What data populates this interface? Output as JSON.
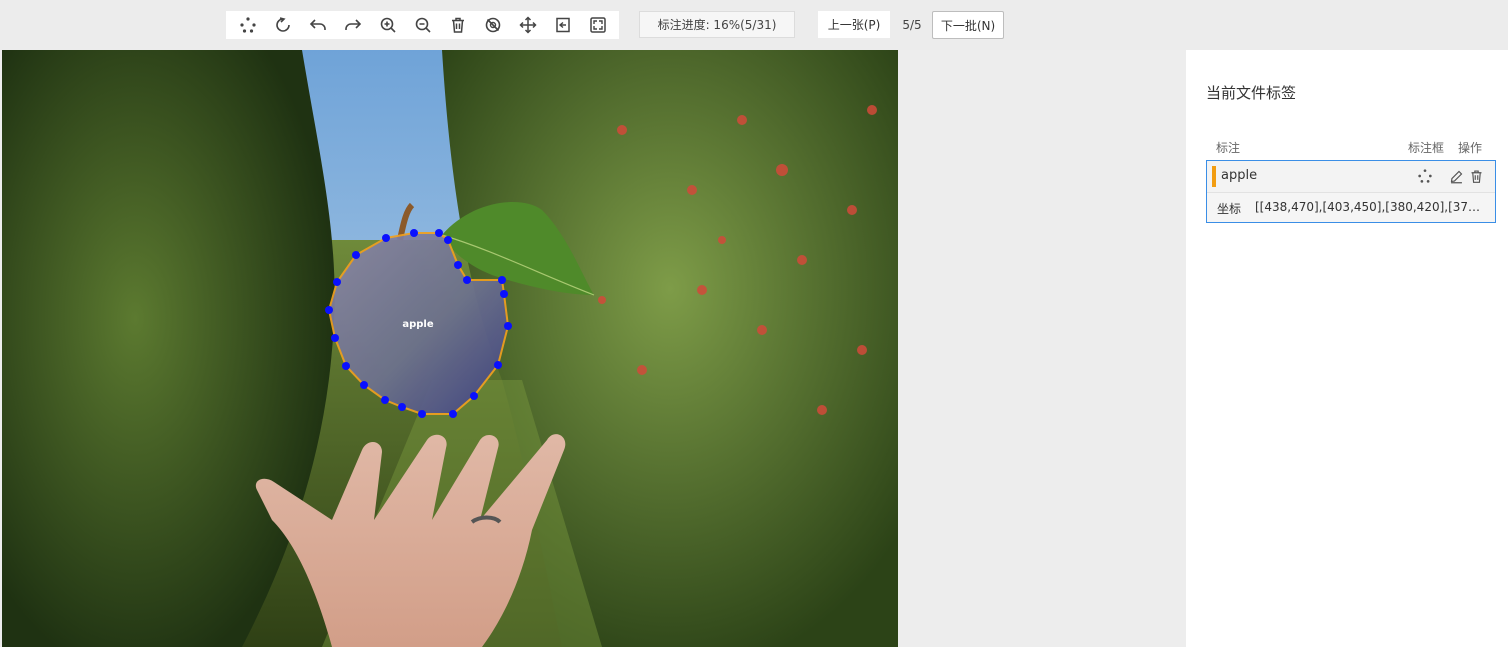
{
  "toolbar": {
    "tools": [
      {
        "name": "polygon-tool",
        "label": "polygon"
      },
      {
        "name": "rotate-tool",
        "label": "rotate"
      },
      {
        "name": "undo",
        "label": "undo"
      },
      {
        "name": "redo",
        "label": "redo"
      },
      {
        "name": "zoom-in",
        "label": "zoom-in"
      },
      {
        "name": "zoom-out",
        "label": "zoom-out"
      },
      {
        "name": "delete",
        "label": "delete"
      },
      {
        "name": "hide",
        "label": "hide"
      },
      {
        "name": "move",
        "label": "move"
      },
      {
        "name": "fit",
        "label": "fit"
      },
      {
        "name": "fullscreen",
        "label": "fullscreen"
      }
    ]
  },
  "progress": {
    "text": "标注进度: 16%(5/31)"
  },
  "nav": {
    "prev_label": "上一张(P)",
    "counter": "5/5",
    "next_label": "下一批(N)"
  },
  "canvas": {
    "annotation_label": "apple"
  },
  "panel": {
    "title": "当前文件标签",
    "col_label": "标注",
    "col_box": "标注框",
    "col_action": "操作",
    "labels": [
      {
        "name": "apple",
        "color": "#f29d12",
        "coord_key": "坐标",
        "coord_value": "[[438,470],[403,450],[380,420],[372,38..."
      }
    ]
  },
  "colors": {
    "polygon_stroke": "#f0a020",
    "vertex": "#0a10ff",
    "selection_border": "#3a8ee6"
  }
}
